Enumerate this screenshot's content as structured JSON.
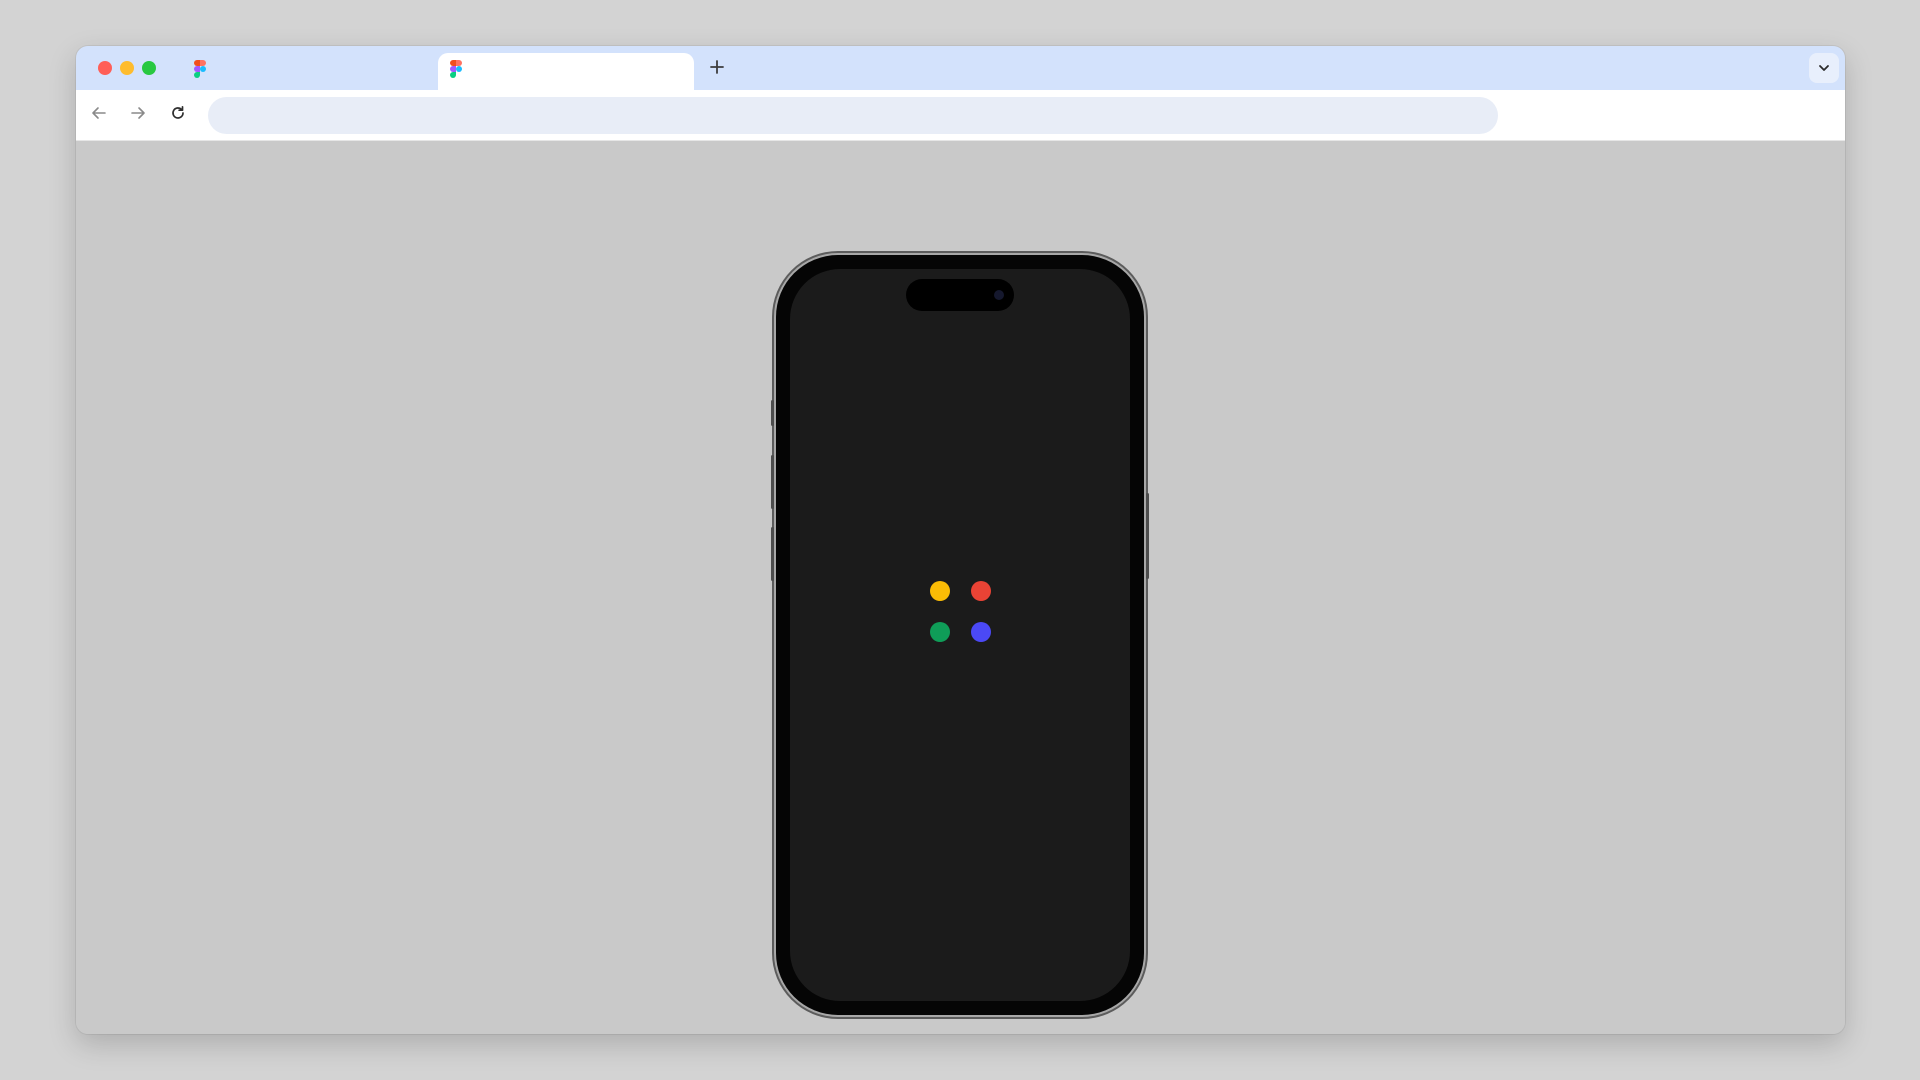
{
  "browser": {
    "tabs": [
      {
        "title": "",
        "favicon": "figma-logo-icon",
        "active": false
      },
      {
        "title": "",
        "favicon": "figma-logo-icon",
        "active": true
      }
    ],
    "new_tab_icon": "plus-icon",
    "tab_menu_icon": "chevron-down-icon",
    "address_bar": {
      "value": "",
      "placeholder": ""
    },
    "nav": {
      "back_icon": "arrow-left-icon",
      "forward_icon": "arrow-right-icon",
      "reload_icon": "reload-icon"
    }
  },
  "colors": {
    "titlebar": "#d3e2fc",
    "toolbar": "#ffffff",
    "omnibox": "#e8edf7",
    "page_background": "#c9c9c9",
    "phone_screen": "#1b1b1b"
  },
  "phone_screen": {
    "loading_indicator": {
      "dots": [
        {
          "name": "yellow-dot",
          "color": "#fbbc05"
        },
        {
          "name": "red-dot",
          "color": "#ea4335"
        },
        {
          "name": "green-dot",
          "color": "#0f9d58"
        },
        {
          "name": "blue-dot",
          "color": "#4b49f5"
        }
      ]
    }
  }
}
